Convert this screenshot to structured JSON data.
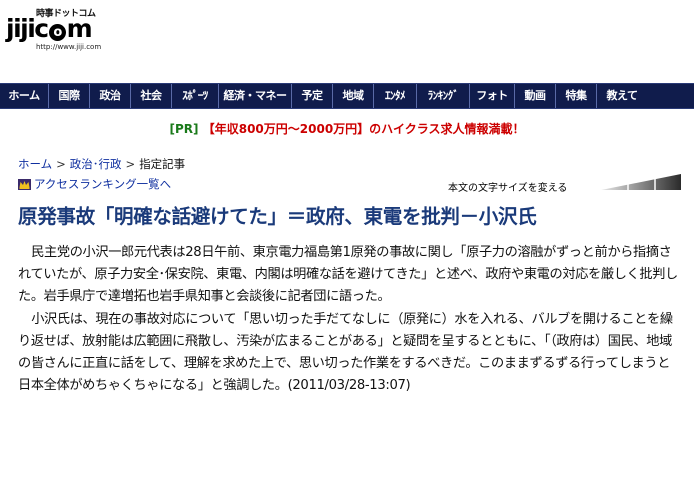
{
  "logo": {
    "kana": "時事ドットコム",
    "text_before": "jiji",
    "text_o": "o",
    "text_after": "m",
    "text_c": "c",
    "url": "http://www.jiji.com"
  },
  "nav": {
    "items": [
      {
        "label": "ホーム",
        "width": 48
      },
      {
        "label": "国際",
        "width": 40
      },
      {
        "label": "政治",
        "width": 40
      },
      {
        "label": "社会",
        "width": 40
      },
      {
        "label": "ｽﾎﾟｰﾂ",
        "width": 46
      },
      {
        "label": "経済・マネー",
        "width": 72
      },
      {
        "label": "予定",
        "width": 40
      },
      {
        "label": "地域",
        "width": 40
      },
      {
        "label": "ｴﾝﾀﾒ",
        "width": 42
      },
      {
        "label": "ﾗﾝｷﾝｸﾞ",
        "width": 52
      },
      {
        "label": "フォト",
        "width": 44
      },
      {
        "label": "動画",
        "width": 40
      },
      {
        "label": "特集",
        "width": 40
      },
      {
        "label": "教えて",
        "width": 50
      }
    ]
  },
  "pr": {
    "tag": "[PR]",
    "link": "【年収800万円～2000万円】のハイクラス求人情報満載！"
  },
  "breadcrumb": {
    "home": "ホーム",
    "section": "政治･行政",
    "current": "指定記事",
    "sep": ">"
  },
  "ranking": {
    "label": "アクセスランキング一覧へ"
  },
  "fontsize": {
    "label": "本文の文字サイズを変える"
  },
  "article": {
    "headline": "原発事故「明確な話避けてた」＝政府、東電を批判－小沢氏",
    "para1": "民主党の小沢一郎元代表は28日午前、東京電力福島第1原発の事故に関し「原子力の溶融がずっと前から指摘されていたが、原子力安全･保安院、東電、内閣は明確な話を避けてきた」と述べ、政府や東電の対応を厳しく批判した。岩手県庁で達増拓也岩手県知事と会談後に記者団に語った。",
    "para2": "小沢氏は、現在の事故対応について「思い切った手だてなしに（原発に）水を入れる、バルブを開けることを繰り返せば、放射能は広範囲に飛散し、汚染が広まることがある」と疑問を呈するとともに、「（政府は）国民、地域の皆さんに正直に話をして、理解を求めた上で、思い切った作業をするべきだ。このままずるずる行ってしまうと日本全体がめちゃくちゃになる」と強調した。",
    "date": "(2011/03/28-13:07)"
  },
  "colors": {
    "nav_bg": "#101c4c",
    "headline": "#1a3a7a",
    "link": "#1030a0",
    "pr_tag": "#1a7a1a",
    "pr_link": "#cc0000"
  }
}
